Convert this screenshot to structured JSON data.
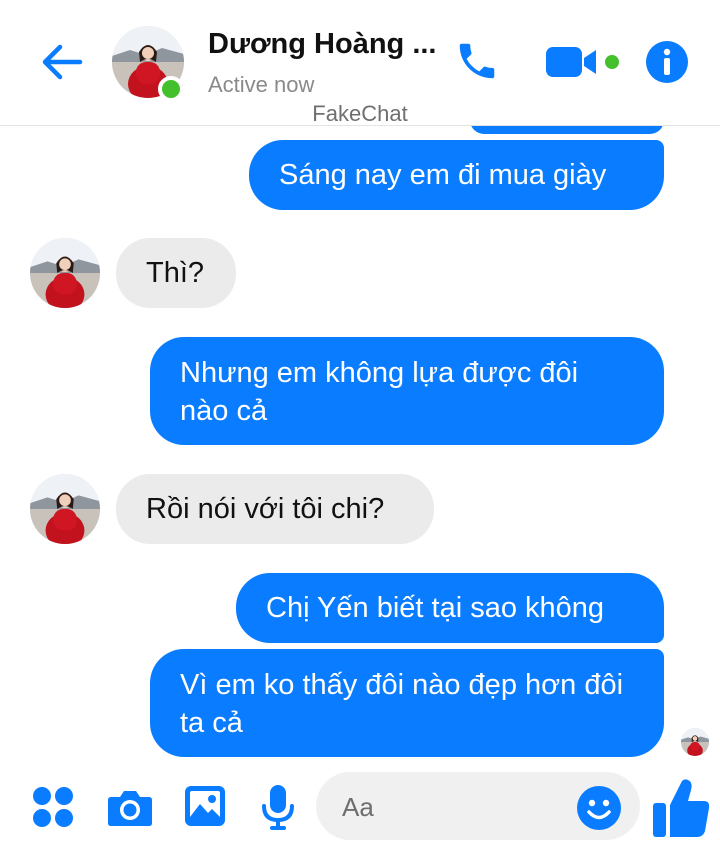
{
  "header": {
    "back_icon": "arrow-left-icon",
    "contact_name": "Dương Hoàng ...",
    "status": "Active now",
    "watermark": "FakeChat",
    "call_icon": "phone-icon",
    "video_icon": "video-camera-icon",
    "info_icon": "info-icon",
    "accent_color": "#0a7cff",
    "online_color": "#44c02d"
  },
  "messages": [
    {
      "side": "out",
      "text": "Sáng nay em đi mua giày"
    },
    {
      "side": "in",
      "text": "Thì?"
    },
    {
      "side": "out",
      "text": "Nhưng em không lựa được đôi nào cả"
    },
    {
      "side": "in",
      "text": "Rồi nói với tôi chi?"
    },
    {
      "side": "out",
      "text": "Chị Yến biết tại sao không"
    },
    {
      "side": "out",
      "text": "Vì em ko thấy đôi nào đẹp hơn đôi ta cả"
    }
  ],
  "composer": {
    "menu_icon": "four-dots-icon",
    "camera_icon": "camera-icon",
    "gallery_icon": "image-icon",
    "mic_icon": "microphone-icon",
    "placeholder": "Aa",
    "emoji_icon": "smiley-icon",
    "like_icon": "thumbs-up-icon"
  }
}
